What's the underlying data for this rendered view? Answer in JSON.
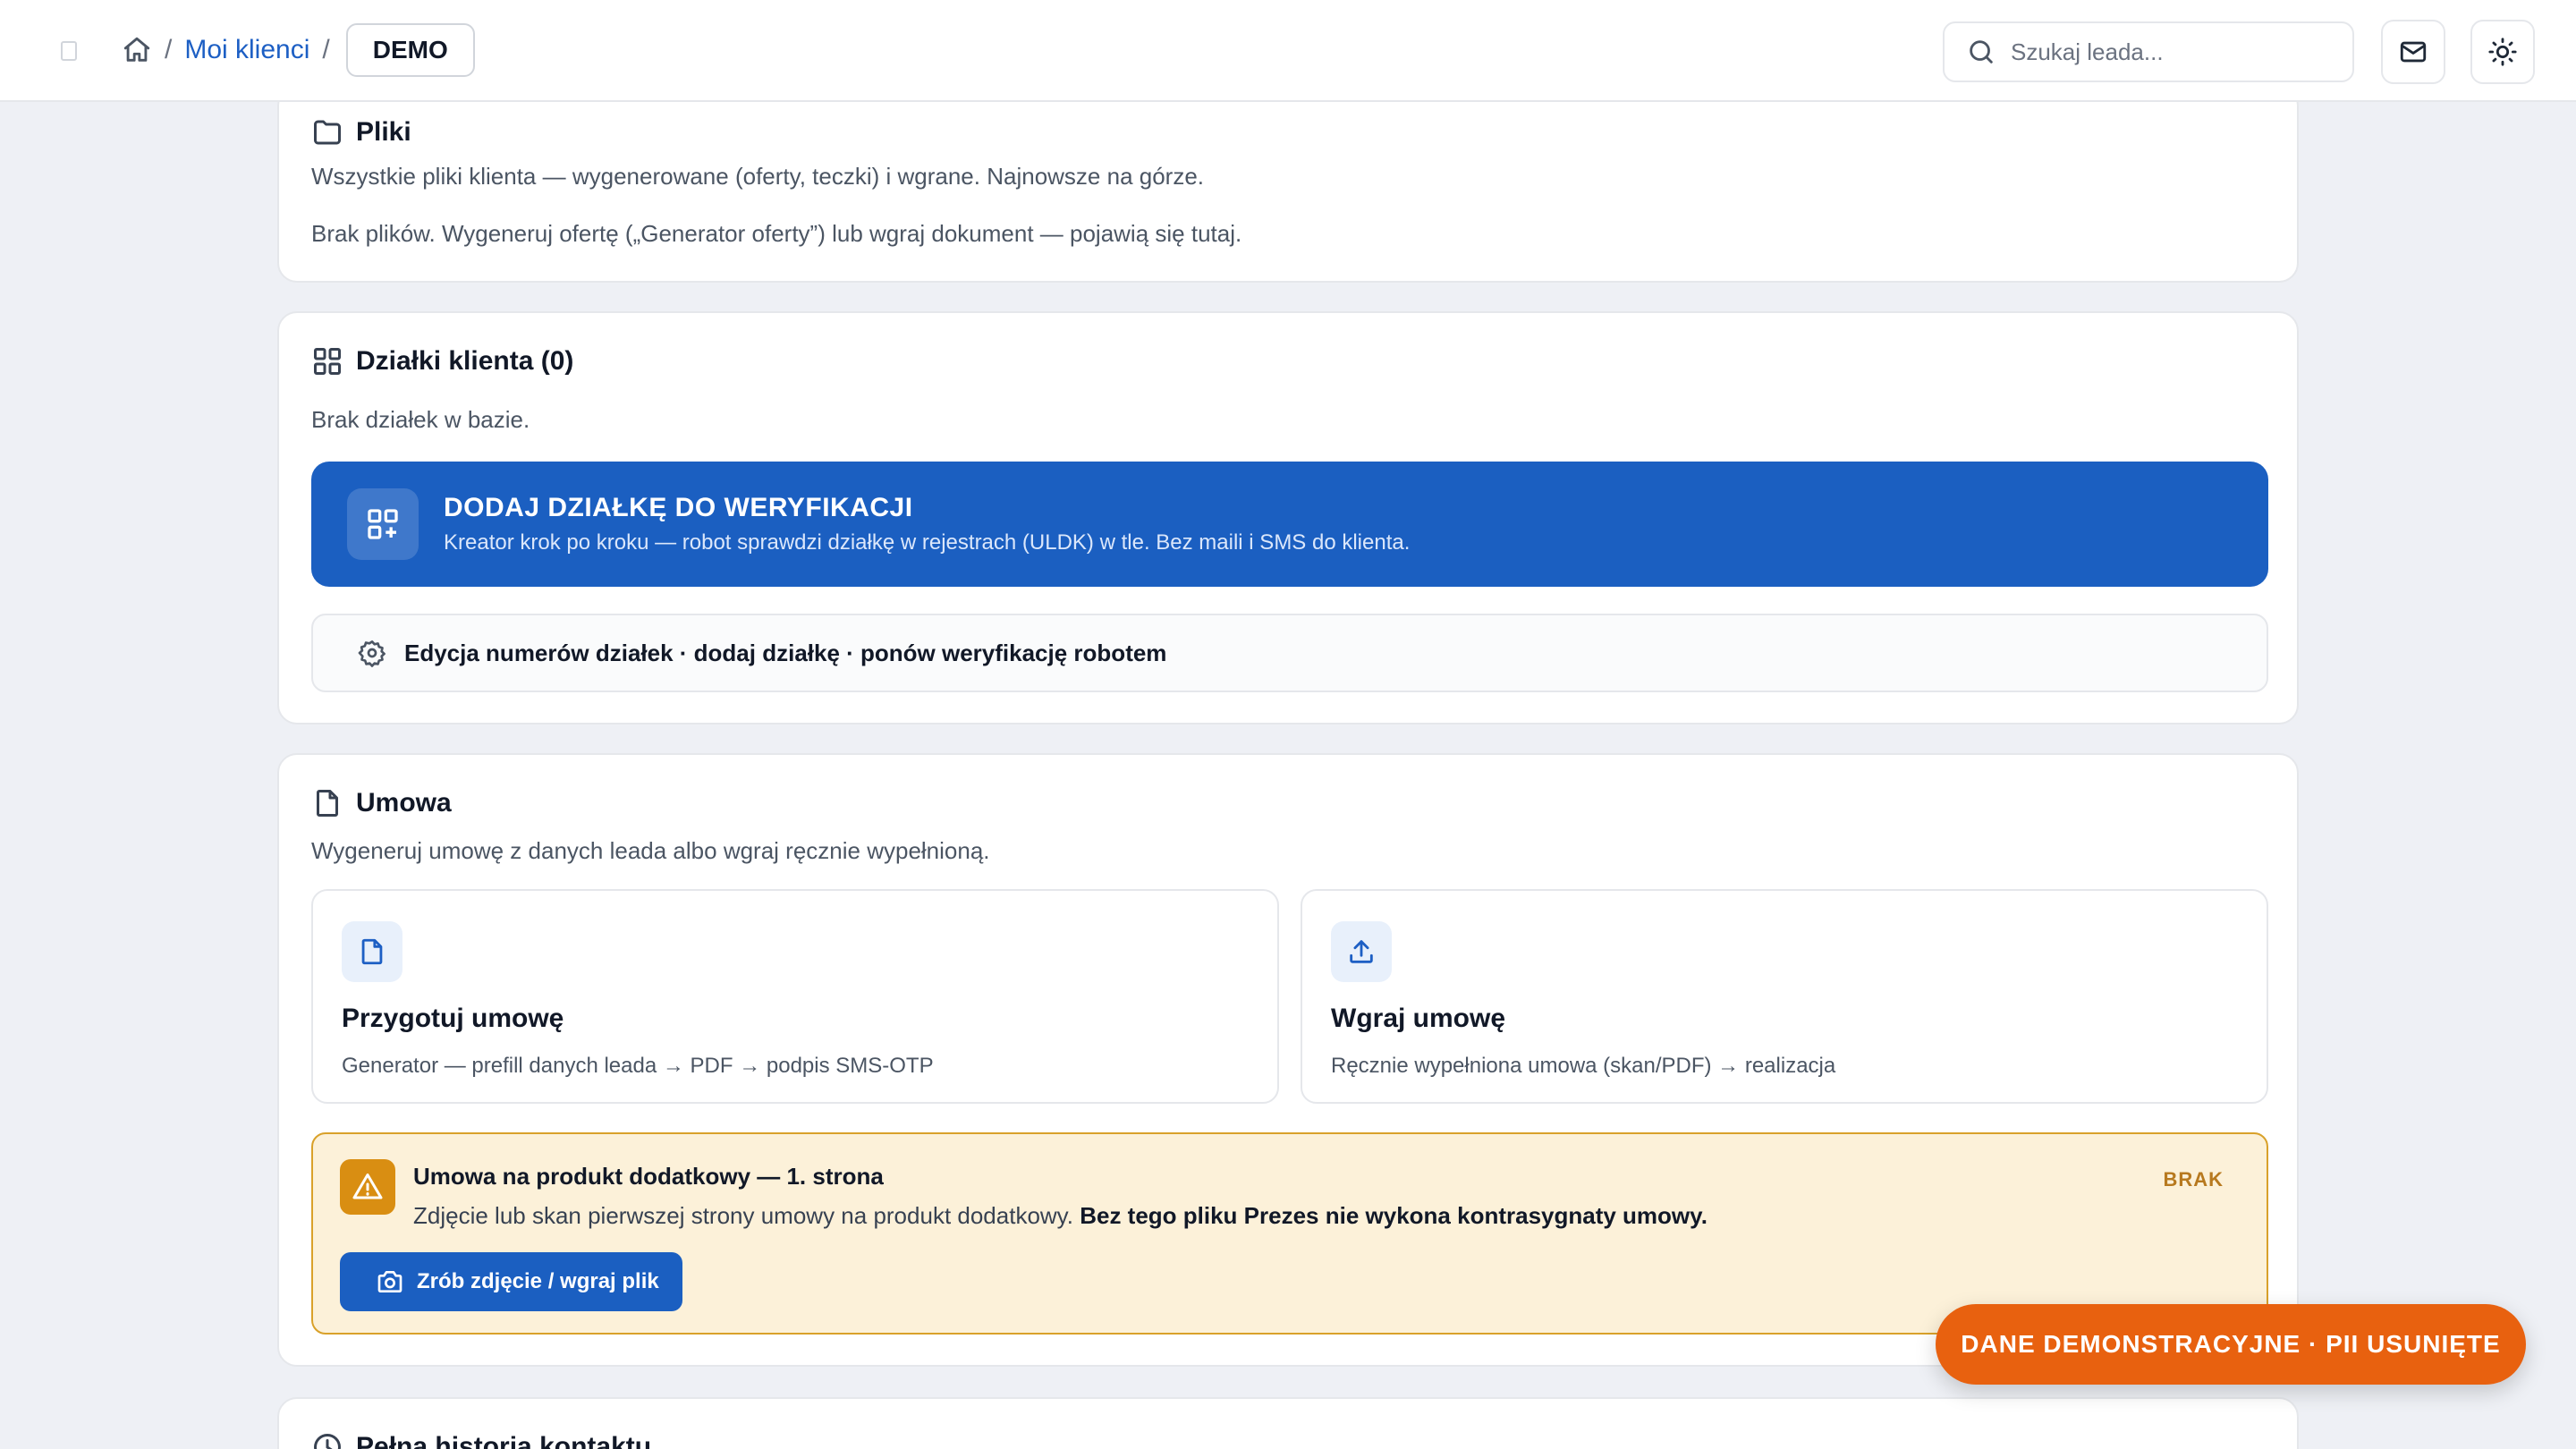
{
  "breadcrumb": {
    "home_icon": "home-icon",
    "section": "Moi klienci",
    "current": "DEMO"
  },
  "search": {
    "placeholder": "Szukaj leada..."
  },
  "header_actions": {
    "mail_icon": "mail-icon",
    "theme_icon": "sun-icon"
  },
  "files": {
    "title": "Pliki",
    "description": "Wszystkie pliki klienta — wygenerowane (oferty, teczki) i wgrane. Najnowsze na górze.",
    "empty_text": "Brak plików. Wygeneruj ofertę („Generator oferty”) lub wgraj dokument — pojawią się tutaj."
  },
  "parcels": {
    "title": "Działki klienta (0)",
    "empty_text": "Brak działek w bazie.",
    "cta_title": "DODAJ DZIAŁKĘ DO WERYFIKACJI",
    "cta_subtitle": "Kreator krok po kroku — robot sprawdzi działkę w rejestrach (ULDK) w tle. Bez maili i SMS do klienta.",
    "edit_label": "Edycja numerów działek · dodaj działkę · ponów weryfikację robotem"
  },
  "contract": {
    "title": "Umowa",
    "description": "Wygeneruj umowę z danych leada albo wgraj ręcznie wypełnioną.",
    "options": [
      {
        "title": "Przygotuj umowę",
        "subtitle": "Generator — prefill danych leada → PDF → podpis SMS-OTP"
      },
      {
        "title": "Wgraj umowę",
        "subtitle": "Ręcznie wypełniona umowa (skan/PDF) → realizacja"
      }
    ],
    "addon": {
      "title": "Umowa na produkt dodatkowy — 1. strona",
      "description": "Zdjęcie lub skan pierwszej strony umowy na produkt dodatkowy. ",
      "description_bold": "Bez tego pliku Prezes nie wykona kontrasygnaty umowy.",
      "status": "BRAK",
      "button_label": "Zrób zdjęcie / wgraj plik"
    }
  },
  "history": {
    "title": "Pełna historia kontaktu"
  },
  "demo_badge": "DANE DEMONSTRACYJNE · PII USUNIĘTE",
  "colors": {
    "primary": "#1b5fc1",
    "warning_bg": "#fcf1d9",
    "warning_border": "#d9a12a",
    "badge": "#e8610f"
  }
}
